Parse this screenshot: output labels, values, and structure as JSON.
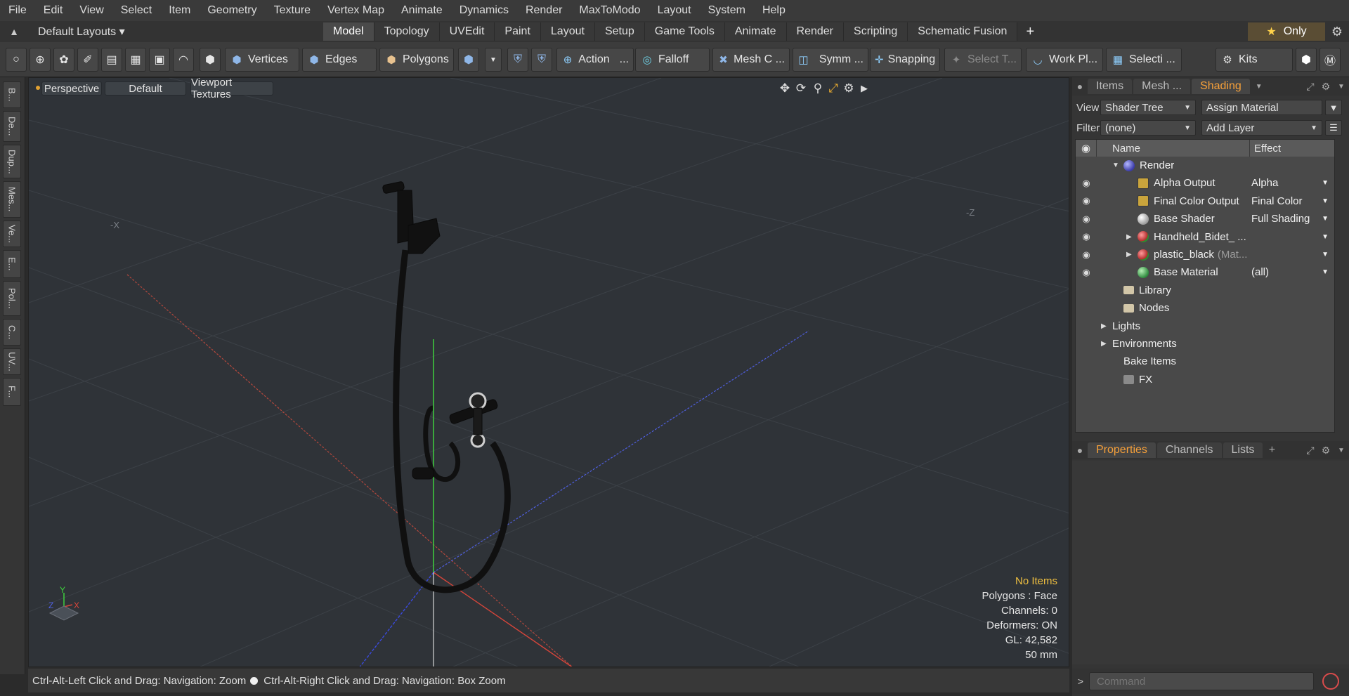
{
  "menu": [
    "File",
    "Edit",
    "View",
    "Select",
    "Item",
    "Geometry",
    "Texture",
    "Vertex Map",
    "Animate",
    "Dynamics",
    "Render",
    "MaxToModo",
    "Layout",
    "System",
    "Help"
  ],
  "layout": {
    "selector": "Default Layouts ▾",
    "tabs": [
      "Model",
      "Topology",
      "UVEdit",
      "Paint",
      "Layout",
      "Setup",
      "Game Tools",
      "Animate",
      "Render",
      "Scripting",
      "Schematic Fusion"
    ],
    "active_tab": "Model",
    "add_tab": "+",
    "only_label": "Only"
  },
  "toolbar": {
    "vertices": "Vertices",
    "edges": "Edges",
    "polygons": "Polygons",
    "action": "Action",
    "action_more": "...",
    "falloff": "Falloff",
    "mesh": "Mesh C ...",
    "symmetry": "Symm ...",
    "snapping": "Snapping",
    "select_t": "Select T...",
    "workplane": "Work Pl...",
    "selection": "Selecti ...",
    "kits": "Kits"
  },
  "left_strip": [
    "B...",
    "De...",
    "Dup...",
    "Mes...",
    "Ve...",
    "E...",
    "Pol...",
    "C...",
    "UV...",
    "F..."
  ],
  "viewport": {
    "view_mode": "Perspective",
    "shading": "Default",
    "textures": "Viewport Textures",
    "info": {
      "selection": "No Items",
      "polygons": "Polygons : Face",
      "channels": "Channels: 0",
      "deformers": "Deformers: ON",
      "gl": "GL: 42,582",
      "grid": "50 mm"
    },
    "axis_labels": {
      "x_neg": "-X",
      "z_neg": "-Z",
      "x": "X",
      "y": "Y",
      "z": "Z"
    }
  },
  "status": {
    "left": "Ctrl-Alt-Left Click and Drag: Navigation: Zoom",
    "right": "Ctrl-Alt-Right Click and Drag: Navigation: Box Zoom"
  },
  "right_panel": {
    "tabs": [
      "Items",
      "Mesh ...",
      "Shading"
    ],
    "active_tab": "Shading",
    "view_label": "View",
    "view_value": "Shader Tree",
    "assign_material": "Assign Material",
    "filter_label": "Filter",
    "filter_value": "(none)",
    "add_layer": "Add Layer",
    "columns": {
      "name": "Name",
      "effect": "Effect"
    },
    "tree": [
      {
        "name": "Render",
        "effect": "",
        "icon": "render-sphere",
        "expanded": true
      },
      {
        "name": "Alpha Output",
        "effect": "Alpha",
        "icon": "output-image"
      },
      {
        "name": "Final Color Output",
        "effect": "Final Color",
        "icon": "output-image"
      },
      {
        "name": "Base Shader",
        "effect": "Full Shading",
        "icon": "shader-sphere"
      },
      {
        "name": "Handheld_Bidet_ ...",
        "effect": "",
        "icon": "material-sphere"
      },
      {
        "name": "plastic_black",
        "suffix": "(Mat...",
        "effect": "",
        "icon": "material-sphere"
      },
      {
        "name": "Base Material",
        "effect": "(all)",
        "icon": "base-material-sphere"
      },
      {
        "name": "Library",
        "effect": "",
        "icon": "folder"
      },
      {
        "name": "Nodes",
        "effect": "",
        "icon": "folder"
      },
      {
        "name": "Lights",
        "effect": "",
        "icon": ""
      },
      {
        "name": "Environments",
        "effect": "",
        "icon": ""
      },
      {
        "name": "Bake Items",
        "effect": "",
        "icon": ""
      },
      {
        "name": "FX",
        "effect": "",
        "icon": "fx-clapper"
      }
    ],
    "lower_tabs": [
      "Properties",
      "Channels",
      "Lists"
    ],
    "lower_active": "Properties",
    "lower_add": "+",
    "command_placeholder": "Command"
  },
  "colors": {
    "accent": "#f6a03a",
    "info_highlight": "#f0c040",
    "viewport_bg": "#2f3338",
    "axis_x": "#d6453a",
    "axis_y": "#3ecf3e",
    "axis_z": "#4f5fe0"
  }
}
